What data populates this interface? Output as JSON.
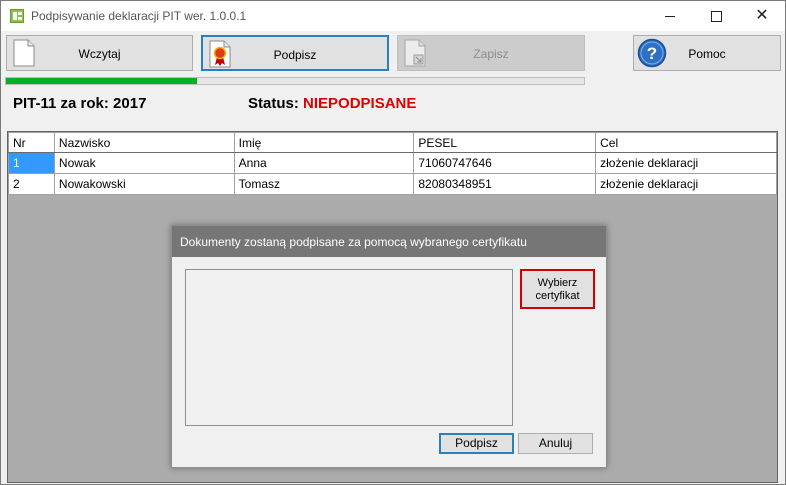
{
  "window": {
    "title": "Podpisywanie deklaracji PIT wer. 1.0.0.1"
  },
  "toolbar": {
    "load_label": "Wczytaj",
    "sign_label": "Podpisz",
    "save_label": "Zapisz",
    "help_label": "Pomoc"
  },
  "progress": {
    "value_percent": 33,
    "color": "#06b025"
  },
  "info": {
    "pit_label": "PIT-11 za rok: 2017",
    "status_label": "Status:",
    "status_value": "NIEPODPISANE",
    "status_color": "#e00000"
  },
  "table": {
    "columns": [
      "Nr",
      "Nazwisko",
      "Imię",
      "PESEL",
      "Cel"
    ],
    "rows": [
      [
        "1",
        "Nowak",
        "Anna",
        "71060747646",
        "złożenie deklaracji"
      ],
      [
        "2",
        "Nowakowski",
        "Tomasz",
        "82080348951",
        "złożenie deklaracji"
      ]
    ]
  },
  "dialog": {
    "title": "Dokumenty zostaną podpisane za pomocą wybranego certyfikatu",
    "choose_label_1": "Wybierz",
    "choose_label_2": "certyfikat",
    "sign_label": "Podpisz",
    "cancel_label": "Anuluj"
  },
  "icons": {
    "load": "document-icon",
    "sign": "certificate-ribbon-icon",
    "save": "document-save-icon",
    "help": "help-question-icon"
  }
}
